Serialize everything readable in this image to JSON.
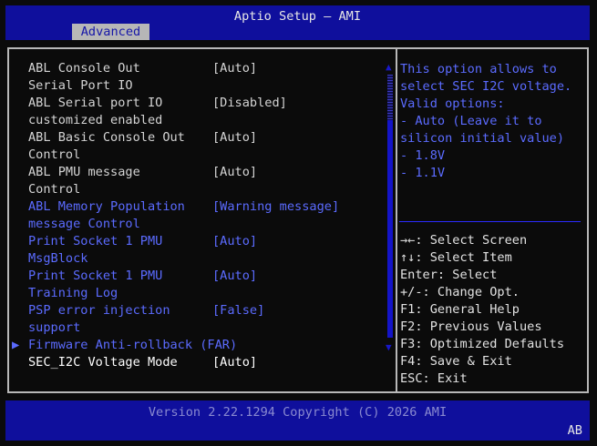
{
  "header": {
    "title": "Aptio Setup – AMI",
    "tab": "Advanced"
  },
  "settings": [
    {
      "label": "ABL Console Out",
      "value": "[Auto]",
      "state": "normal"
    },
    {
      "label": "Serial Port IO",
      "value": "",
      "state": "normal"
    },
    {
      "label": "ABL Serial port IO",
      "value": "[Disabled]",
      "state": "normal"
    },
    {
      "label": "customized enabled",
      "value": "",
      "state": "normal"
    },
    {
      "label": "ABL Basic Console Out",
      "value": "[Auto]",
      "state": "normal"
    },
    {
      "label": "Control",
      "value": "",
      "state": "normal"
    },
    {
      "label": "ABL PMU message",
      "value": "[Auto]",
      "state": "normal"
    },
    {
      "label": "Control",
      "value": "",
      "state": "normal"
    },
    {
      "label": "ABL Memory Population",
      "value": "[Warning message]",
      "state": "highlight"
    },
    {
      "label": "message Control",
      "value": "",
      "state": "highlight"
    },
    {
      "label": "Print Socket 1 PMU",
      "value": "[Auto]",
      "state": "highlight"
    },
    {
      "label": "MsgBlock",
      "value": "",
      "state": "highlight"
    },
    {
      "label": "Print Socket 1 PMU",
      "value": "[Auto]",
      "state": "highlight"
    },
    {
      "label": "Training Log",
      "value": "",
      "state": "highlight"
    },
    {
      "label": "PSP error injection",
      "value": "[False]",
      "state": "highlight"
    },
    {
      "label": "support",
      "value": "",
      "state": "highlight"
    },
    {
      "label": "Firmware Anti-rollback (FAR)",
      "value": "",
      "state": "submenu"
    },
    {
      "label": "SEC_I2C Voltage Mode",
      "value": "[Auto]",
      "state": "selected"
    }
  ],
  "submenu_arrow": "▶",
  "help": {
    "lines": [
      "This option allows to",
      "select SEC I2C voltage.",
      "Valid options:",
      "- Auto (Leave it to",
      "silicon initial value)",
      "- 1.8V",
      "- 1.1V"
    ]
  },
  "keys": [
    "→←: Select Screen",
    "↑↓: Select Item",
    "Enter: Select",
    "+/-: Change Opt.",
    "F1: General Help",
    "F2: Previous Values",
    "F3: Optimized Defaults",
    "F4: Save & Exit",
    "ESC: Exit"
  ],
  "footer": {
    "version": "Version 2.22.1294 Copyright (C) 2026 AMI",
    "indicator": "AB"
  },
  "scroll": {
    "up_glyph": "▲",
    "down_glyph": "▼",
    "position": 0.17
  },
  "colors": {
    "bar_blue": "#0f0f9c",
    "highlight_blue": "#5b6bff",
    "text_grey": "#d4d4d4",
    "border_grey": "#b8b8b8"
  }
}
